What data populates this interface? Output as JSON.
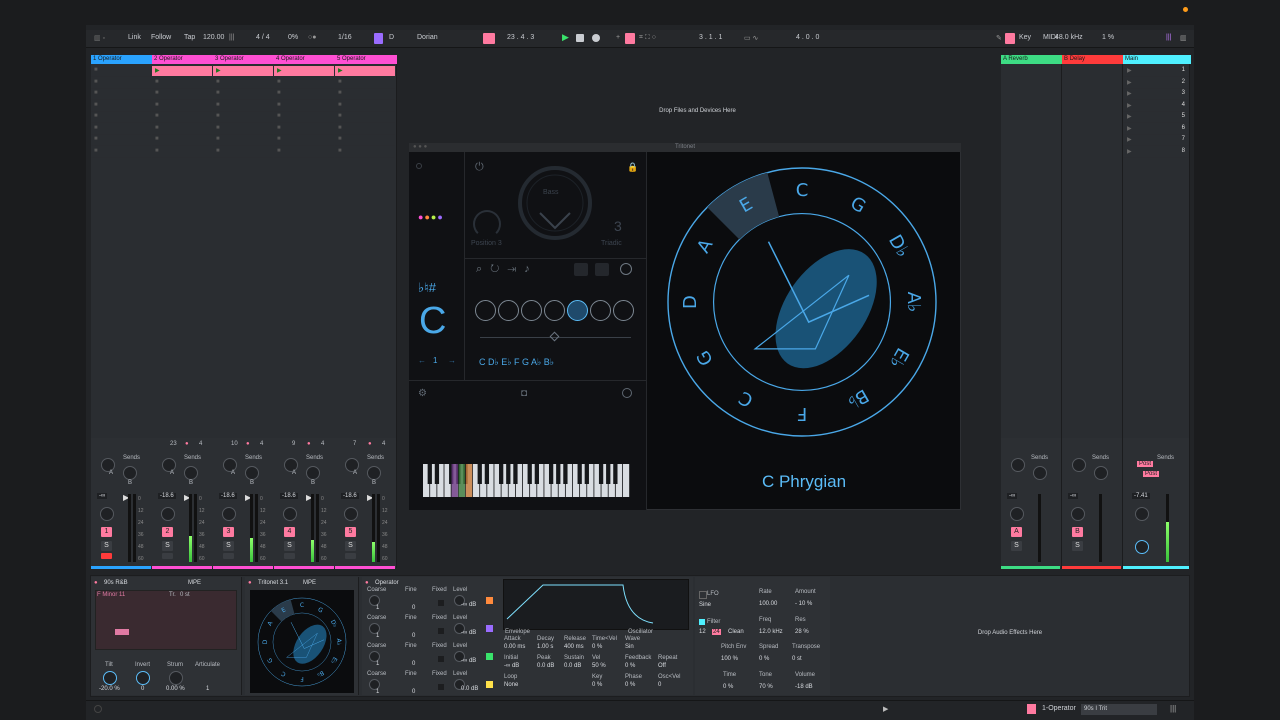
{
  "topbar": {
    "link": "Link",
    "follow": "Follow",
    "tap": "Tap",
    "tempo": "120.00",
    "signature": "4 / 4",
    "cpu_pct": "0%",
    "quantize": "1/16",
    "key_root": "D",
    "scale": "Dorian",
    "position": "23 .  4 .  3",
    "loop_start": "3 .  1 .  1",
    "loop_len": "4 .  0 .  0",
    "key": "Key",
    "midi": "MIDI",
    "sample_rate": "48.0 kHz",
    "cpu": "1 %"
  },
  "tracks": [
    {
      "name": "1 Operator",
      "color": "#2aa3ff",
      "clip_color": null,
      "number": "1",
      "volume": "-∞",
      "slot_count": "",
      "scene_num": ""
    },
    {
      "name": "2 Operator",
      "color": "#ff4fd3",
      "clip_color": "#ff7aa0",
      "number": "2",
      "volume": "-18.6",
      "slot_count": "23",
      "scene_num": "4"
    },
    {
      "name": "3 Operator",
      "color": "#ff4fd3",
      "clip_color": "#ff7aa0",
      "number": "3",
      "volume": "-18.6",
      "slot_count": "10",
      "scene_num": "4"
    },
    {
      "name": "4 Operator",
      "color": "#ff4fd3",
      "clip_color": "#ff7aa0",
      "number": "4",
      "volume": "-18.6",
      "slot_count": "9",
      "scene_num": "4"
    },
    {
      "name": "5 Operator",
      "color": "#ff4fd3",
      "clip_color": "#ff7aa0",
      "number": "5",
      "volume": "-18.6",
      "slot_count": "7",
      "scene_num": "4"
    }
  ],
  "returns": [
    {
      "name": "A Reverb",
      "color": "#3ddc84",
      "letter": "A",
      "volume": "-∞"
    },
    {
      "name": "B Delay",
      "color": "#ff3b3b",
      "letter": "B",
      "volume": "-∞"
    }
  ],
  "main": {
    "name": "Main",
    "color": "#4ff0ff",
    "volume": "-7.41",
    "scenes": [
      "1",
      "2",
      "3",
      "4",
      "5",
      "6",
      "7",
      "8"
    ],
    "post1": "Post",
    "post2": "Post"
  },
  "mixer_labels": {
    "sends": "Sends",
    "a": "A",
    "b": "B",
    "s": "S",
    "db_scale": [
      "0",
      "12",
      "24",
      "36",
      "48",
      "60"
    ]
  },
  "drop_files": "Drop Files and Devices Here",
  "drop_effects": "Drop Audio Effects Here",
  "tritonet": {
    "title": "Tritonet",
    "position": "Position 3",
    "triadic": "Triadic",
    "triad_num": "3",
    "accidentals": "♭♮#",
    "root": "C",
    "octave": "1",
    "notes": "C D♭ E♭ F G A♭ B♭",
    "scale_name": "C Phrygian",
    "wheel": [
      "C",
      "G",
      "D♭",
      "A♭",
      "E♭",
      "B♭",
      "F",
      "C",
      "G",
      "D",
      "A",
      "E"
    ]
  },
  "devices": {
    "chord": {
      "name": "90s R&B",
      "mpe": "MPE",
      "chord": "F Minor 11",
      "tr": "Tr.",
      "st": "0 st",
      "tilt": "Tilt",
      "invert": "Invert",
      "strum": "Strum",
      "articulate": "Articulate",
      "tilt_v": "-20.0 %",
      "invert_v": "0",
      "strum_v": "0.00 %",
      "artic_v": "1"
    },
    "tritonet": {
      "name": "Tritonet 3.1",
      "mpe": "MPE"
    },
    "operator": {
      "name": "Operator",
      "coarse": "Coarse",
      "fine": "Fine",
      "fixed": "Fixed",
      "level": "Level",
      "osc_rows": [
        {
          "coarse": "1",
          "fine": "0",
          "level": "-∞ dB"
        },
        {
          "coarse": "1",
          "fine": "0",
          "level": "-∞ dB"
        },
        {
          "coarse": "1",
          "fine": "0",
          "level": "-∞ dB"
        },
        {
          "coarse": "1",
          "fine": "0",
          "level": "0.0 dB"
        }
      ],
      "envelope": "Envelope",
      "oscillator": "Oscillator",
      "attack": "Attack",
      "decay": "Decay",
      "release": "Release",
      "time_vel": "Time<Vel",
      "attack_v": "0.00 ms",
      "decay_v": "1.00 s",
      "release_v": "400 ms",
      "time_vel_v": "0 %",
      "initial": "Initial",
      "peak": "Peak",
      "sustain": "Sustain",
      "vel": "Vel",
      "initial_v": "-∞ dB",
      "peak_v": "0.0 dB",
      "sustain_v": "0.0 dB",
      "vel_v": "50 %",
      "loop": "Loop",
      "loop_v": "None",
      "key": "Key",
      "key_v": "0 %",
      "wave": "Wave",
      "wave_v": "Sin",
      "feedback": "Feedback",
      "repeat": "Repeat",
      "feedback_v": "0 %",
      "repeat_v": "Off",
      "phase": "Phase",
      "phase_v": "0 %",
      "oscvel": "Osc<Vel",
      "oscvel_v": "0",
      "lfo": "LFO",
      "lfo_wave": "Sine",
      "rate": "Rate",
      "rate_v": "100.00",
      "amount": "Amount",
      "amount_v": "- 10 %",
      "filter": "Filter",
      "filter_a": "12",
      "filter_b": "24",
      "clean": "Clean",
      "freq": "Freq",
      "freq_v": "12.0 kHz",
      "res": "Res",
      "res_v": "28 %",
      "pitch_env": "Pitch Env",
      "pitch_env_v": "100 %",
      "spread": "Spread",
      "spread_v": "0 %",
      "transpose": "Transpose",
      "transpose_v": "0 st",
      "time": "Time",
      "time_v": "0 %",
      "tone": "Tone",
      "tone_v": "70 %",
      "volume": "Volume",
      "volume_v": "-18 dB"
    }
  },
  "status": {
    "track": "1-Operator",
    "clip": "90s I Trit"
  }
}
